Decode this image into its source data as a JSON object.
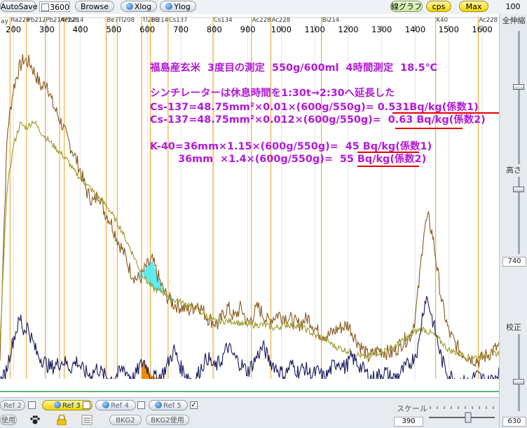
{
  "toolbar": {
    "autosave_label": "AutoSave",
    "count_value": "3600",
    "browse_label": "Browse",
    "xlog_label": "Xlog",
    "ylog_label": "Ylog",
    "line_graph_label": "線グラフ",
    "cps_label": "cps",
    "max_label": "Max",
    "max_value": "100"
  },
  "chart_data": {
    "type": "line",
    "title": "",
    "xlabel": "",
    "ylabel": "",
    "xlim": [
      160,
      1650
    ],
    "ylim": [
      0,
      100
    ],
    "x_ticks": [
      200,
      300,
      400,
      500,
      600,
      700,
      800,
      900,
      1000,
      1100,
      1200,
      1300,
      1400,
      1500,
      1600
    ],
    "x_tick_labels": [
      "200",
      "300",
      "400",
      "500",
      "600",
      "700",
      "800",
      "900",
      "1000",
      "1100",
      "1200",
      "1300",
      "1400",
      "1500",
      "1600"
    ],
    "left_edge_label": "ay",
    "isotope_markers": [
      {
        "label": "Ra226",
        "x": 190
      },
      {
        "label": "Pb212",
        "x": 239
      },
      {
        "label": "Pb214",
        "x": 295
      },
      {
        "label": "Ac228",
        "x": 338
      },
      {
        "label": "Pb214",
        "x": 352
      },
      {
        "label": "Be7",
        "x": 477
      },
      {
        "label": "Tl208",
        "x": 510
      },
      {
        "label": "Tl208",
        "x": 583
      },
      {
        "label": "Bi214",
        "x": 609
      },
      {
        "label": "Cs137",
        "x": 662
      },
      {
        "label": "Cs134",
        "x": 796
      },
      {
        "label": "Ac228",
        "x": 911
      },
      {
        "label": "Ac228",
        "x": 969
      },
      {
        "label": "Bi214",
        "x": 1120
      },
      {
        "label": "K40",
        "x": 1461
      },
      {
        "label": "Ac228",
        "x": 1588
      }
    ],
    "series": [
      {
        "name": "",
        "color": "#8a5a1e",
        "points": [
          [
            160,
            8
          ],
          [
            170,
            40
          ],
          [
            182,
            72
          ],
          [
            200,
            84
          ],
          [
            215,
            89
          ],
          [
            230,
            92
          ],
          [
            250,
            91
          ],
          [
            265,
            88
          ],
          [
            285,
            84
          ],
          [
            300,
            86
          ],
          [
            315,
            80
          ],
          [
            330,
            77
          ],
          [
            345,
            74
          ],
          [
            360,
            70
          ],
          [
            380,
            66
          ],
          [
            400,
            61
          ],
          [
            420,
            55
          ],
          [
            440,
            52
          ],
          [
            455,
            55
          ],
          [
            470,
            50
          ],
          [
            490,
            47
          ],
          [
            510,
            42
          ],
          [
            530,
            38
          ],
          [
            550,
            33
          ],
          [
            565,
            31
          ],
          [
            580,
            31
          ],
          [
            595,
            34
          ],
          [
            615,
            36
          ],
          [
            630,
            32
          ],
          [
            650,
            27
          ],
          [
            675,
            24
          ],
          [
            700,
            23
          ],
          [
            725,
            22
          ],
          [
            750,
            24
          ],
          [
            780,
            20
          ],
          [
            810,
            18
          ],
          [
            840,
            23
          ],
          [
            860,
            20
          ],
          [
            880,
            23
          ],
          [
            900,
            18
          ],
          [
            930,
            23
          ],
          [
            960,
            19
          ],
          [
            990,
            21
          ],
          [
            1020,
            20
          ],
          [
            1050,
            18
          ],
          [
            1080,
            20
          ],
          [
            1110,
            16
          ],
          [
            1140,
            15
          ],
          [
            1170,
            17
          ],
          [
            1200,
            18
          ],
          [
            1230,
            13
          ],
          [
            1260,
            9
          ],
          [
            1290,
            11
          ],
          [
            1330,
            10
          ],
          [
            1360,
            13
          ],
          [
            1385,
            15
          ],
          [
            1400,
            20
          ],
          [
            1415,
            33
          ],
          [
            1425,
            44
          ],
          [
            1438,
            48
          ],
          [
            1452,
            43
          ],
          [
            1465,
            34
          ],
          [
            1480,
            24
          ],
          [
            1500,
            16
          ],
          [
            1530,
            11
          ],
          [
            1560,
            9
          ],
          [
            1590,
            8
          ],
          [
            1620,
            10
          ],
          [
            1650,
            12
          ]
        ]
      },
      {
        "name": "",
        "color": "#9c9a28",
        "points": [
          [
            160,
            12
          ],
          [
            180,
            55
          ],
          [
            200,
            68
          ],
          [
            220,
            74
          ],
          [
            240,
            73
          ],
          [
            260,
            75
          ],
          [
            280,
            72
          ],
          [
            300,
            70
          ],
          [
            320,
            68
          ],
          [
            340,
            66
          ],
          [
            360,
            64
          ],
          [
            380,
            61
          ],
          [
            400,
            59
          ],
          [
            420,
            57
          ],
          [
            440,
            55
          ],
          [
            460,
            53
          ],
          [
            480,
            51
          ],
          [
            500,
            48
          ],
          [
            520,
            45
          ],
          [
            540,
            41
          ],
          [
            560,
            37
          ],
          [
            580,
            33
          ],
          [
            600,
            30
          ],
          [
            620,
            28
          ],
          [
            650,
            27
          ],
          [
            680,
            25
          ],
          [
            710,
            24
          ],
          [
            740,
            23
          ],
          [
            770,
            21
          ],
          [
            800,
            19
          ],
          [
            830,
            19
          ],
          [
            860,
            19
          ],
          [
            890,
            18
          ],
          [
            920,
            18
          ],
          [
            950,
            18
          ],
          [
            980,
            17
          ],
          [
            1010,
            18
          ],
          [
            1040,
            18
          ],
          [
            1070,
            17
          ],
          [
            1100,
            15
          ],
          [
            1130,
            14
          ],
          [
            1160,
            12
          ],
          [
            1190,
            11
          ],
          [
            1220,
            10
          ],
          [
            1250,
            9
          ],
          [
            1280,
            10
          ],
          [
            1310,
            11
          ],
          [
            1340,
            12
          ],
          [
            1370,
            14
          ],
          [
            1400,
            16
          ],
          [
            1420,
            17
          ],
          [
            1440,
            16
          ],
          [
            1460,
            15
          ],
          [
            1480,
            13
          ],
          [
            1500,
            11
          ],
          [
            1530,
            10
          ],
          [
            1560,
            9
          ],
          [
            1590,
            9
          ],
          [
            1620,
            10
          ],
          [
            1650,
            10
          ]
        ]
      },
      {
        "name": "",
        "color": "#1a1a5e",
        "points": [
          [
            160,
            2
          ],
          [
            175,
            4
          ],
          [
            190,
            10
          ],
          [
            200,
            14
          ],
          [
            210,
            17
          ],
          [
            222,
            20
          ],
          [
            230,
            16
          ],
          [
            240,
            18
          ],
          [
            255,
            14
          ],
          [
            270,
            10
          ],
          [
            290,
            8
          ],
          [
            310,
            6
          ],
          [
            330,
            7
          ],
          [
            350,
            8
          ],
          [
            370,
            6
          ],
          [
            390,
            8
          ],
          [
            410,
            5
          ],
          [
            430,
            4
          ],
          [
            450,
            6
          ],
          [
            470,
            4
          ],
          [
            490,
            3
          ],
          [
            510,
            4
          ],
          [
            530,
            6
          ],
          [
            545,
            4
          ],
          [
            560,
            3
          ],
          [
            575,
            6
          ],
          [
            590,
            8
          ],
          [
            610,
            4
          ],
          [
            630,
            3
          ],
          [
            650,
            5
          ],
          [
            665,
            8
          ],
          [
            680,
            11
          ],
          [
            700,
            6
          ],
          [
            720,
            4
          ],
          [
            740,
            2
          ],
          [
            760,
            6
          ],
          [
            780,
            9
          ],
          [
            800,
            6
          ],
          [
            820,
            8
          ],
          [
            840,
            12
          ],
          [
            860,
            9
          ],
          [
            880,
            7
          ],
          [
            900,
            5
          ],
          [
            920,
            8
          ],
          [
            945,
            12
          ],
          [
            965,
            8
          ],
          [
            985,
            6
          ],
          [
            1010,
            4
          ],
          [
            1030,
            7
          ],
          [
            1050,
            5
          ],
          [
            1070,
            6
          ],
          [
            1090,
            4
          ],
          [
            1110,
            5
          ],
          [
            1130,
            3
          ],
          [
            1150,
            6
          ],
          [
            1170,
            8
          ],
          [
            1190,
            6
          ],
          [
            1210,
            9
          ],
          [
            1230,
            7
          ],
          [
            1250,
            5
          ],
          [
            1270,
            3
          ],
          [
            1290,
            4
          ],
          [
            1310,
            5
          ],
          [
            1330,
            3
          ],
          [
            1350,
            4
          ],
          [
            1370,
            6
          ],
          [
            1390,
            8
          ],
          [
            1410,
            12
          ],
          [
            1420,
            20
          ],
          [
            1432,
            26
          ],
          [
            1440,
            24
          ],
          [
            1450,
            20
          ],
          [
            1465,
            14
          ],
          [
            1480,
            8
          ],
          [
            1500,
            4
          ],
          [
            1520,
            3
          ],
          [
            1540,
            2
          ],
          [
            1560,
            2
          ],
          [
            1580,
            4
          ],
          [
            1600,
            3
          ],
          [
            1620,
            2
          ],
          [
            1650,
            5
          ]
        ]
      }
    ],
    "shaded_regions": [
      {
        "name": "Cs-137 region",
        "color": "#44e6f0",
        "x_range": [
          577,
          679
        ]
      },
      {
        "name": "Cs-134 orange",
        "color": "#f08a00",
        "x_range": [
          583,
          640
        ]
      }
    ]
  },
  "annotation": {
    "line1": "福島産玄米  3度目の測定  550g/600ml  4時間測定  18.5℃",
    "line2": "シンチレーターは休息時間を1:30t→2:30へ延長した",
    "line3": "Cs-137=48.75mm²×0.01×(600g/550g)= 0.531Bq/kg(係数1)",
    "line4": "Cs-137=48.75mm²×0.012×(600g/550g)=  0.63 Bq/kg(係数2)",
    "line5": "K-40=36mm×1.15×(600g/550g)=  45 Bq/kg(係数1)",
    "line6": "        36mm  ×1.4×(600g/550g)=  55 Bq/kg(係数2)"
  },
  "right_panel": {
    "label_top": "全伸縮",
    "label_height": "高さ",
    "height_value": "740",
    "label_calib": "校正",
    "calib_value": "630"
  },
  "bottom_bar": {
    "ref_buttons": [
      {
        "label": "Ref 2",
        "checked": false
      },
      {
        "label": "Ref 3",
        "checked": false
      },
      {
        "label": "Ref 4",
        "checked": false
      },
      {
        "label": "Ref 5",
        "checked": true
      }
    ],
    "use_label": "使用",
    "bkg2_label": "BKG2",
    "bkg2_use_label": "BKG2使用",
    "scale_label": "スケール",
    "scale_value": "390",
    "checkmark": "✓"
  }
}
